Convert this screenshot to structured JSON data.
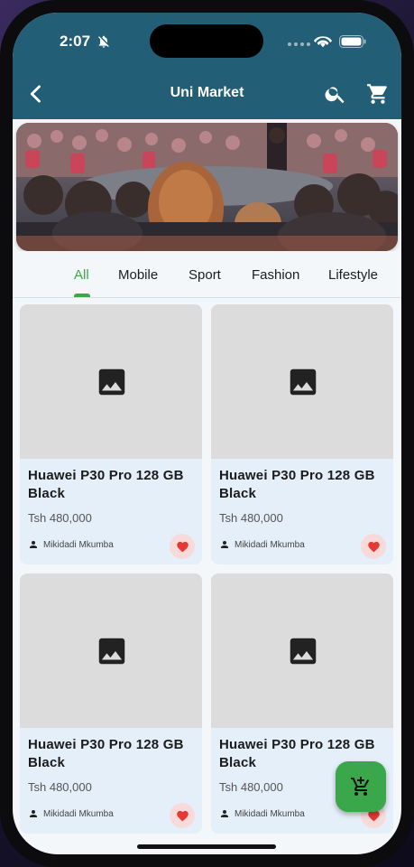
{
  "status": {
    "time": "2:07"
  },
  "appbar": {
    "title": "Uni Market"
  },
  "tabs": [
    {
      "label": "All",
      "active": true
    },
    {
      "label": "Mobile",
      "active": false
    },
    {
      "label": "Sport",
      "active": false
    },
    {
      "label": "Fashion",
      "active": false
    },
    {
      "label": "Lifestyle",
      "active": false
    }
  ],
  "products": [
    {
      "name": "Huawei P30 Pro 128 GB Black",
      "price": "Tsh 480,000",
      "seller": "Mikidadi Mkumba",
      "favorite": true
    },
    {
      "name": "Huawei P30 Pro 128 GB Black",
      "price": "Tsh 480,000",
      "seller": "Mikidadi Mkumba",
      "favorite": true
    },
    {
      "name": "Huawei P30 Pro 128 GB Black",
      "price": "Tsh 480,000",
      "seller": "Mikidadi Mkumba",
      "favorite": true
    },
    {
      "name": "Huawei P30 Pro 128 GB Black",
      "price": "Tsh 480,000",
      "seller": "Mikidadi Mkumba",
      "favorite": true
    }
  ],
  "icons": {
    "back": "back-arrow-icon",
    "search": "search-icon",
    "cart": "shopping-cart-icon",
    "fab": "add-to-cart-icon",
    "image_placeholder": "image-icon",
    "seller": "person-icon",
    "favorite": "heart-icon"
  },
  "colors": {
    "appbar": "#225e75",
    "accent": "#3aa84a",
    "card": "#e4effa",
    "heart": "#e53935"
  }
}
